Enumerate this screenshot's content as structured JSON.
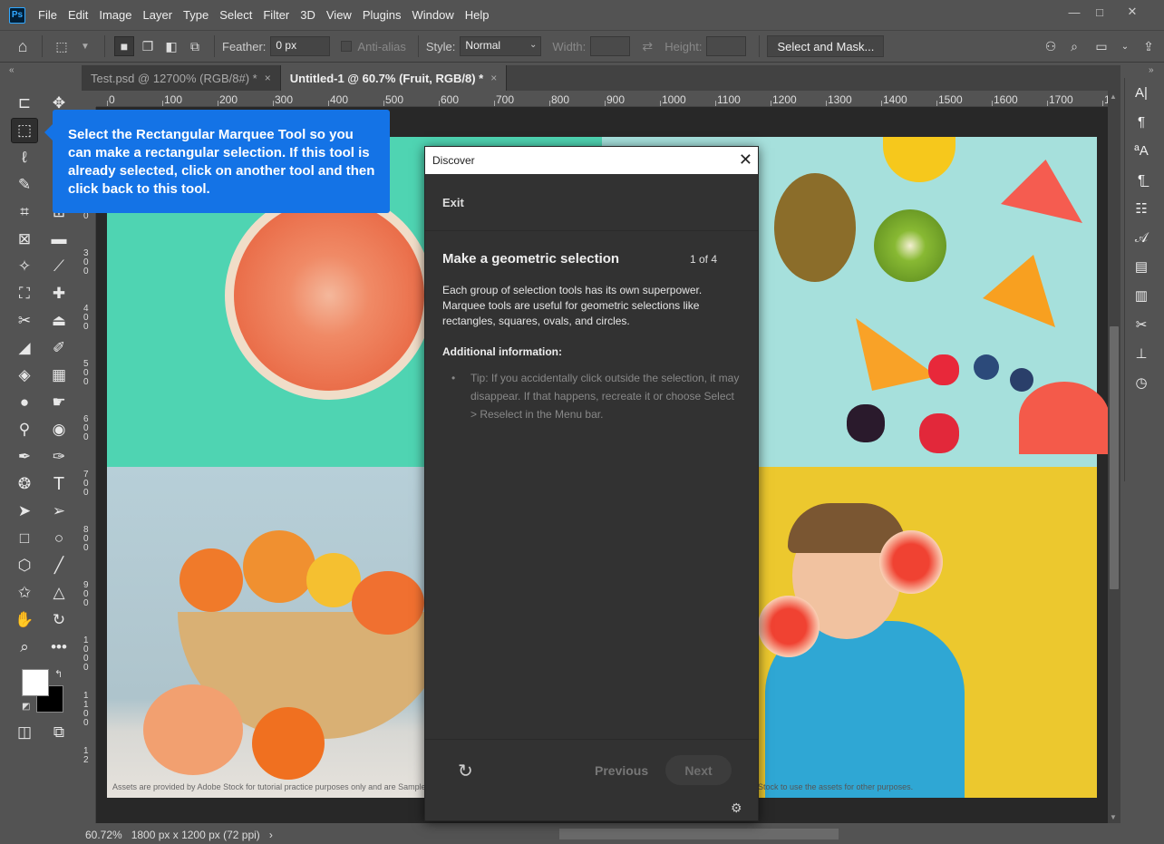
{
  "app": {
    "logo": "Ps"
  },
  "menu": [
    "File",
    "Edit",
    "Image",
    "Layer",
    "Type",
    "Select",
    "Filter",
    "3D",
    "View",
    "Plugins",
    "Window",
    "Help"
  ],
  "window_controls": {
    "minimize": "—",
    "restore": "□",
    "close": "✕"
  },
  "options_bar": {
    "feather_label": "Feather:",
    "feather_value": "0 px",
    "antialias_label": "Anti-alias",
    "style_label": "Style:",
    "style_value": "Normal",
    "width_label": "Width:",
    "height_label": "Height:",
    "select_mask_label": "Select and Mask..."
  },
  "tabs": [
    {
      "label": "Test.psd @ 12700% (RGB/8#) *",
      "close": "×"
    },
    {
      "label": "Untitled-1 @ 60.7% (Fruit, RGB/8) *",
      "close": "×"
    }
  ],
  "ruler_top": [
    "0",
    "100",
    "200",
    "300",
    "400",
    "500",
    "600",
    "700",
    "800",
    "900",
    "1000",
    "1100",
    "1200",
    "1300",
    "1400",
    "1500",
    "1600",
    "1700",
    "1"
  ],
  "ruler_left": [
    "1\n0\n0",
    "2\n0\n0",
    "3\n0\n0",
    "4\n0\n0",
    "5\n0\n0",
    "6\n0\n0",
    "7\n0\n0",
    "8\n0\n0",
    "9\n0\n0",
    "1\n0\n0\n0",
    "1\n1\n0\n0",
    "1\n2"
  ],
  "tooltip": {
    "text": "Select the Rectangular Marquee Tool so you can make a rectangular selection. If this tool is already selected, click on another tool and then click back to this tool."
  },
  "discover": {
    "title": "Discover",
    "close": "✕",
    "exit": "Exit",
    "heading": "Make a geometric selection",
    "step": "1 of 4",
    "body": "Each group of selection tools has its own superpower. Marquee tools are useful for geometric selections like rectangles, squares, ovals, and circles.",
    "additional_label": "Additional information:",
    "tip": "Tip: If you accidentally click outside the selection, it may disappear. If that happens, recreate it or choose Select > Reselect in the Menu bar.",
    "prev": "Previous",
    "next": "Next"
  },
  "canvas_caption_left": "Assets are provided by Adobe Stock for tutorial practice purposes only and are Sample in",
  "canvas_caption_right": "Stock to use the assets for other purposes.",
  "status": {
    "zoom": "60.72%",
    "doc": "1800 px x 1200 px (72 ppi)",
    "arrow": "›"
  },
  "colors": {
    "accent": "#1473e6",
    "panel": "#535353",
    "dialog": "#323232"
  }
}
